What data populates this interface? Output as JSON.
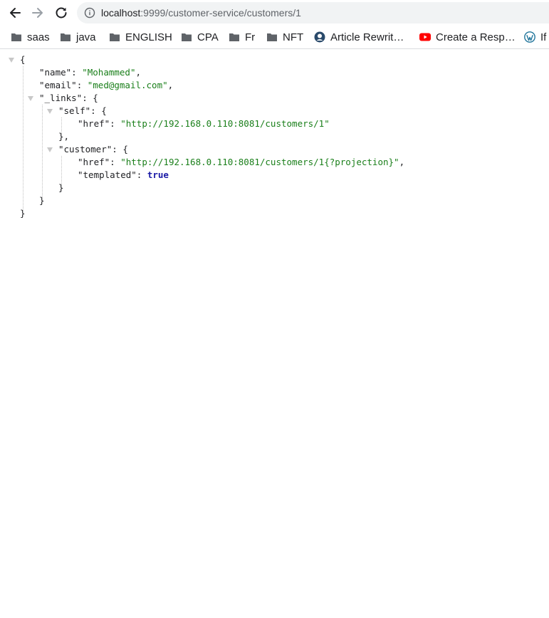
{
  "browser": {
    "url_host": "localhost",
    "url_path": ":9999/customer-service/customers/1"
  },
  "bookmarks": [
    {
      "label": "saas",
      "icon": "folder-icon"
    },
    {
      "label": "java",
      "icon": "folder-icon"
    },
    {
      "label": "ENGLISH",
      "icon": "folder-icon"
    },
    {
      "label": "CPA",
      "icon": "folder-icon"
    },
    {
      "label": "Fr",
      "icon": "folder-icon"
    },
    {
      "label": "NFT",
      "icon": "folder-icon"
    },
    {
      "label": "Article Rewrit…",
      "icon": "article-rewriter-icon"
    },
    {
      "label": "Create a Resp…",
      "icon": "youtube-icon"
    },
    {
      "label": "If",
      "icon": "wordpress-icon"
    }
  ],
  "json": {
    "open_brace": "{",
    "close_brace": "}",
    "name_key": "\"name\"",
    "name_value": "\"Mohammed\"",
    "email_key": "\"email\"",
    "email_value": "\"med@gmail.com\"",
    "links_key": "\"_links\"",
    "self_key": "\"self\"",
    "self_href_key": "\"href\"",
    "self_href_value": "\"http://192.168.0.110:8081/customers/1\"",
    "customer_key": "\"customer\"",
    "customer_href_key": "\"href\"",
    "customer_href_value": "\"http://192.168.0.110:8081/customers/1{?projection}\"",
    "templated_key": "\"templated\"",
    "templated_value": "true"
  }
}
